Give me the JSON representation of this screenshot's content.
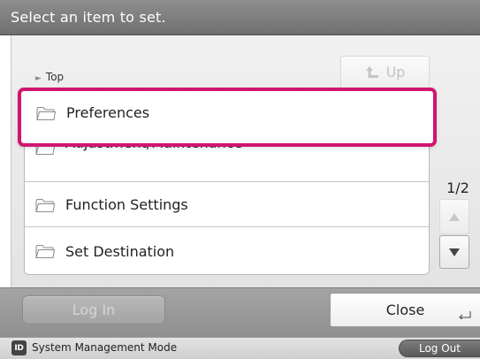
{
  "header": {
    "title": "Select an item to set."
  },
  "navigation": {
    "breadcrumb": "Top",
    "up_label": "Up"
  },
  "menu": {
    "items": [
      {
        "label": "Preferences",
        "icon": "folder-icon",
        "selected": true
      },
      {
        "label": "Adjustment/Maintenance",
        "icon": "folder-icon"
      },
      {
        "label": "Function Settings",
        "icon": "folder-icon"
      },
      {
        "label": "Set Destination",
        "icon": "folder-icon"
      }
    ]
  },
  "pagination": {
    "indicator": "1/2"
  },
  "footer": {
    "login_label": "Log In",
    "close_label": "Close"
  },
  "status": {
    "id_badge": "ID",
    "mode": "System Management Mode",
    "logout_label": "Log Out"
  },
  "colors": {
    "selection": "#d2156f",
    "header": "#7e7e7e",
    "footer": "#999999"
  }
}
